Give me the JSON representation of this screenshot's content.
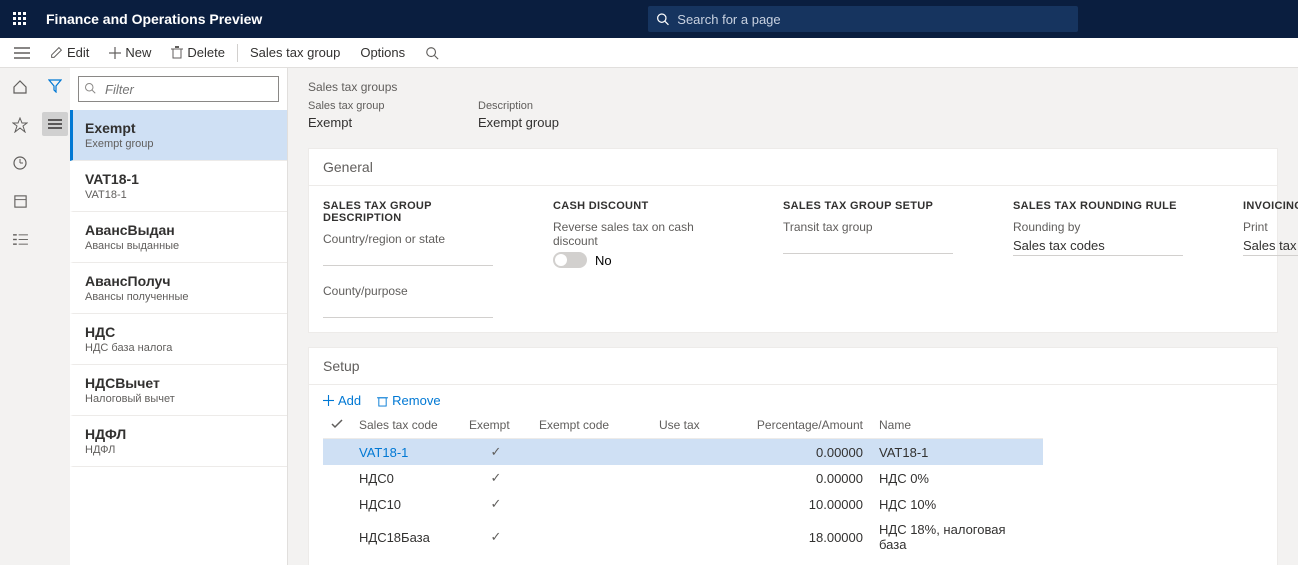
{
  "app_title": "Finance and Operations Preview",
  "search_placeholder": "Search for a page",
  "actions": {
    "edit": "Edit",
    "new": "New",
    "delete": "Delete",
    "entity": "Sales tax group",
    "options": "Options"
  },
  "list_filter_placeholder": "Filter",
  "list": [
    {
      "title": "Exempt",
      "sub": "Exempt group",
      "selected": true
    },
    {
      "title": "VAT18-1",
      "sub": "VAT18-1",
      "selected": false
    },
    {
      "title": "АвансВыдан",
      "sub": "Авансы выданные",
      "selected": false
    },
    {
      "title": "АвансПолуч",
      "sub": "Авансы полученные",
      "selected": false
    },
    {
      "title": "НДС",
      "sub": "НДС база налога",
      "selected": false
    },
    {
      "title": "НДСВычет",
      "sub": "Налоговый вычет",
      "selected": false
    },
    {
      "title": "НДФЛ",
      "sub": "НДФЛ",
      "selected": false
    }
  ],
  "breadcrumb": "Sales tax groups",
  "record": {
    "group_label": "Sales tax group",
    "group_value": "Exempt",
    "desc_label": "Description",
    "desc_value": "Exempt group"
  },
  "general": {
    "title": "General",
    "desc_group": "SALES TAX GROUP DESCRIPTION",
    "country_label": "Country/region or state",
    "county_label": "County/purpose",
    "cash_group": "CASH DISCOUNT",
    "reverse_label": "Reverse sales tax on cash discount",
    "reverse_value": "No",
    "setup_group": "SALES TAX GROUP SETUP",
    "transit_label": "Transit tax group",
    "rounding_group": "SALES TAX ROUNDING RULE",
    "rounding_label": "Rounding by",
    "rounding_value": "Sales tax codes",
    "invoicing_group": "INVOICING",
    "print_label": "Print",
    "print_value": "Sales tax codes"
  },
  "setup": {
    "title": "Setup",
    "add": "Add",
    "remove": "Remove",
    "columns": {
      "code": "Sales tax code",
      "exempt": "Exempt",
      "exempt_code": "Exempt code",
      "use_tax": "Use tax",
      "pct": "Percentage/Amount",
      "name": "Name"
    },
    "rows": [
      {
        "code": "VAT18-1",
        "exempt": true,
        "exempt_code": "",
        "use_tax": "",
        "pct": "0.00000",
        "name": "VAT18-1",
        "selected": true
      },
      {
        "code": "НДС0",
        "exempt": true,
        "exempt_code": "",
        "use_tax": "",
        "pct": "0.00000",
        "name": "НДС 0%",
        "selected": false
      },
      {
        "code": "НДС10",
        "exempt": true,
        "exempt_code": "",
        "use_tax": "",
        "pct": "10.00000",
        "name": "НДС 10%",
        "selected": false
      },
      {
        "code": "НДС18База",
        "exempt": true,
        "exempt_code": "",
        "use_tax": "",
        "pct": "18.00000",
        "name": "НДС 18%, налоговая база",
        "selected": false
      }
    ]
  }
}
